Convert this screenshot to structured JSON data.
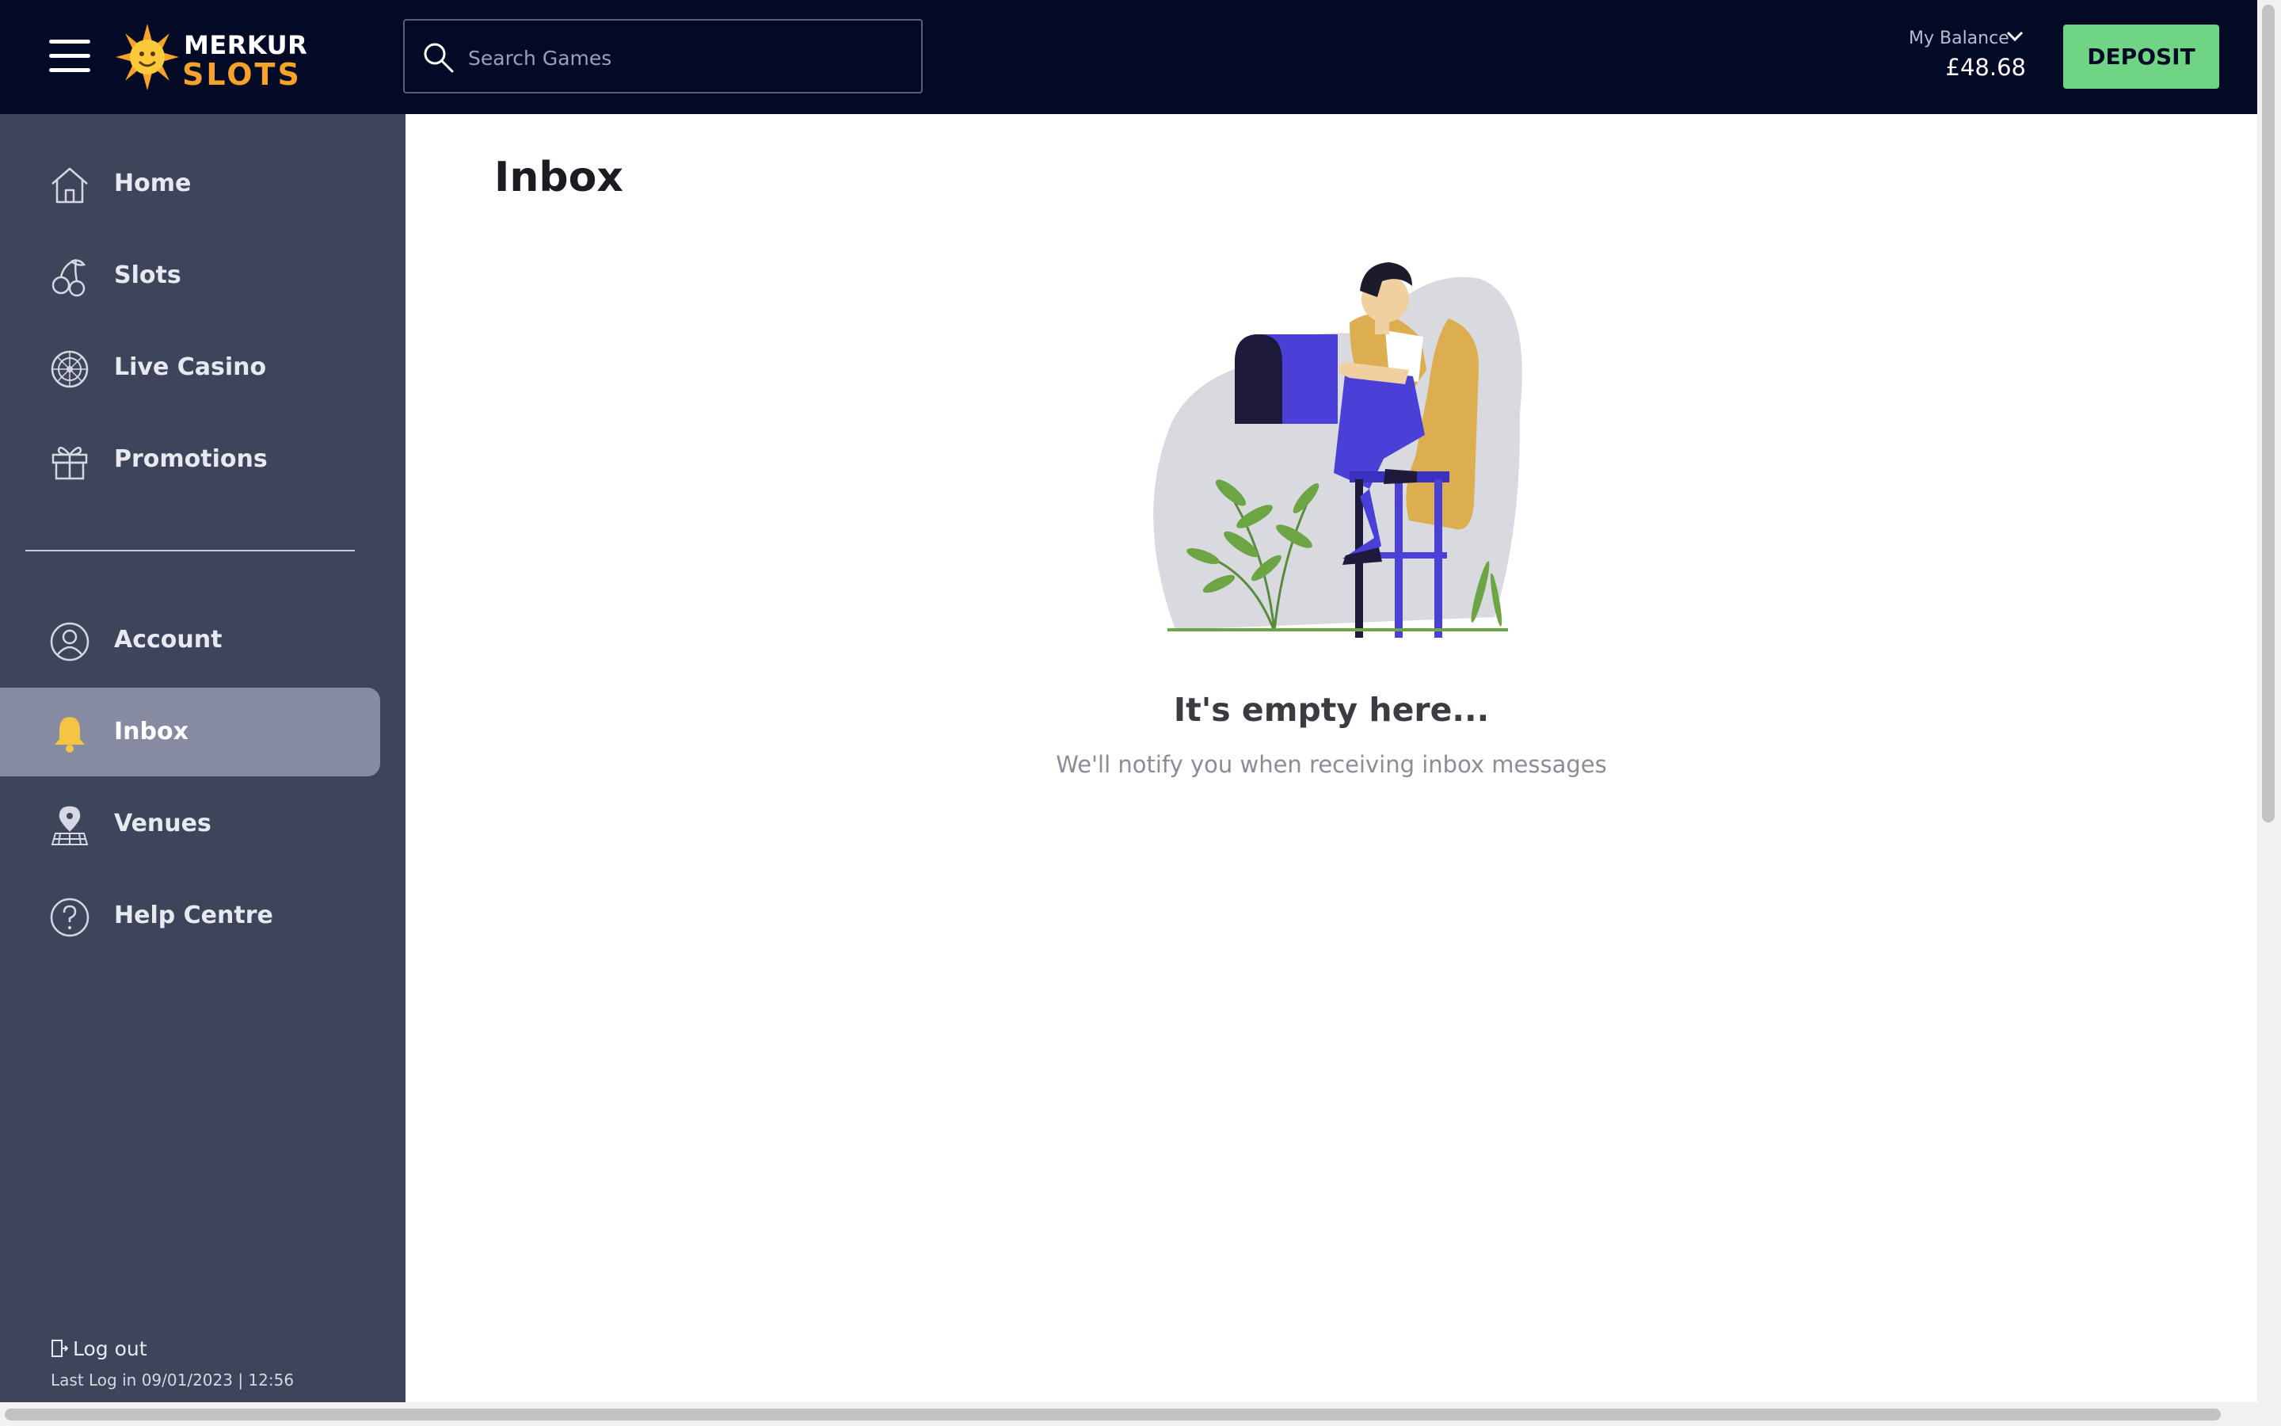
{
  "header": {
    "logo_line1": "MERKUR",
    "logo_line2": "SLOTS",
    "search_placeholder": "Search Games",
    "balance_label": "My Balance",
    "balance_value": "£48.68",
    "deposit_label": "DEPOSIT"
  },
  "sidebar": {
    "items": [
      {
        "label": "Home",
        "icon": "home-icon"
      },
      {
        "label": "Slots",
        "icon": "cherries-icon"
      },
      {
        "label": "Live Casino",
        "icon": "roulette-icon"
      },
      {
        "label": "Promotions",
        "icon": "gift-icon"
      },
      {
        "label": "Account",
        "icon": "user-icon"
      },
      {
        "label": "Inbox",
        "icon": "bell-icon",
        "active": true
      },
      {
        "label": "Venues",
        "icon": "map-pin-icon"
      },
      {
        "label": "Help Centre",
        "icon": "help-icon"
      }
    ],
    "logout_label": "Log out",
    "last_login": "Last Log in 09/01/2023 | 12:56"
  },
  "main": {
    "title": "Inbox",
    "empty_title": "It's empty here...",
    "empty_subtitle": "We'll notify you when receiving inbox messages"
  },
  "colors": {
    "topbar": "#030a26",
    "sidebar": "#3e4459",
    "sidebar_active": "#868ba1",
    "deposit": "#6fd483",
    "logo_gold": "#f7a32b",
    "illustration_purple": "#4a3fd6",
    "illustration_gold": "#dcae50"
  }
}
